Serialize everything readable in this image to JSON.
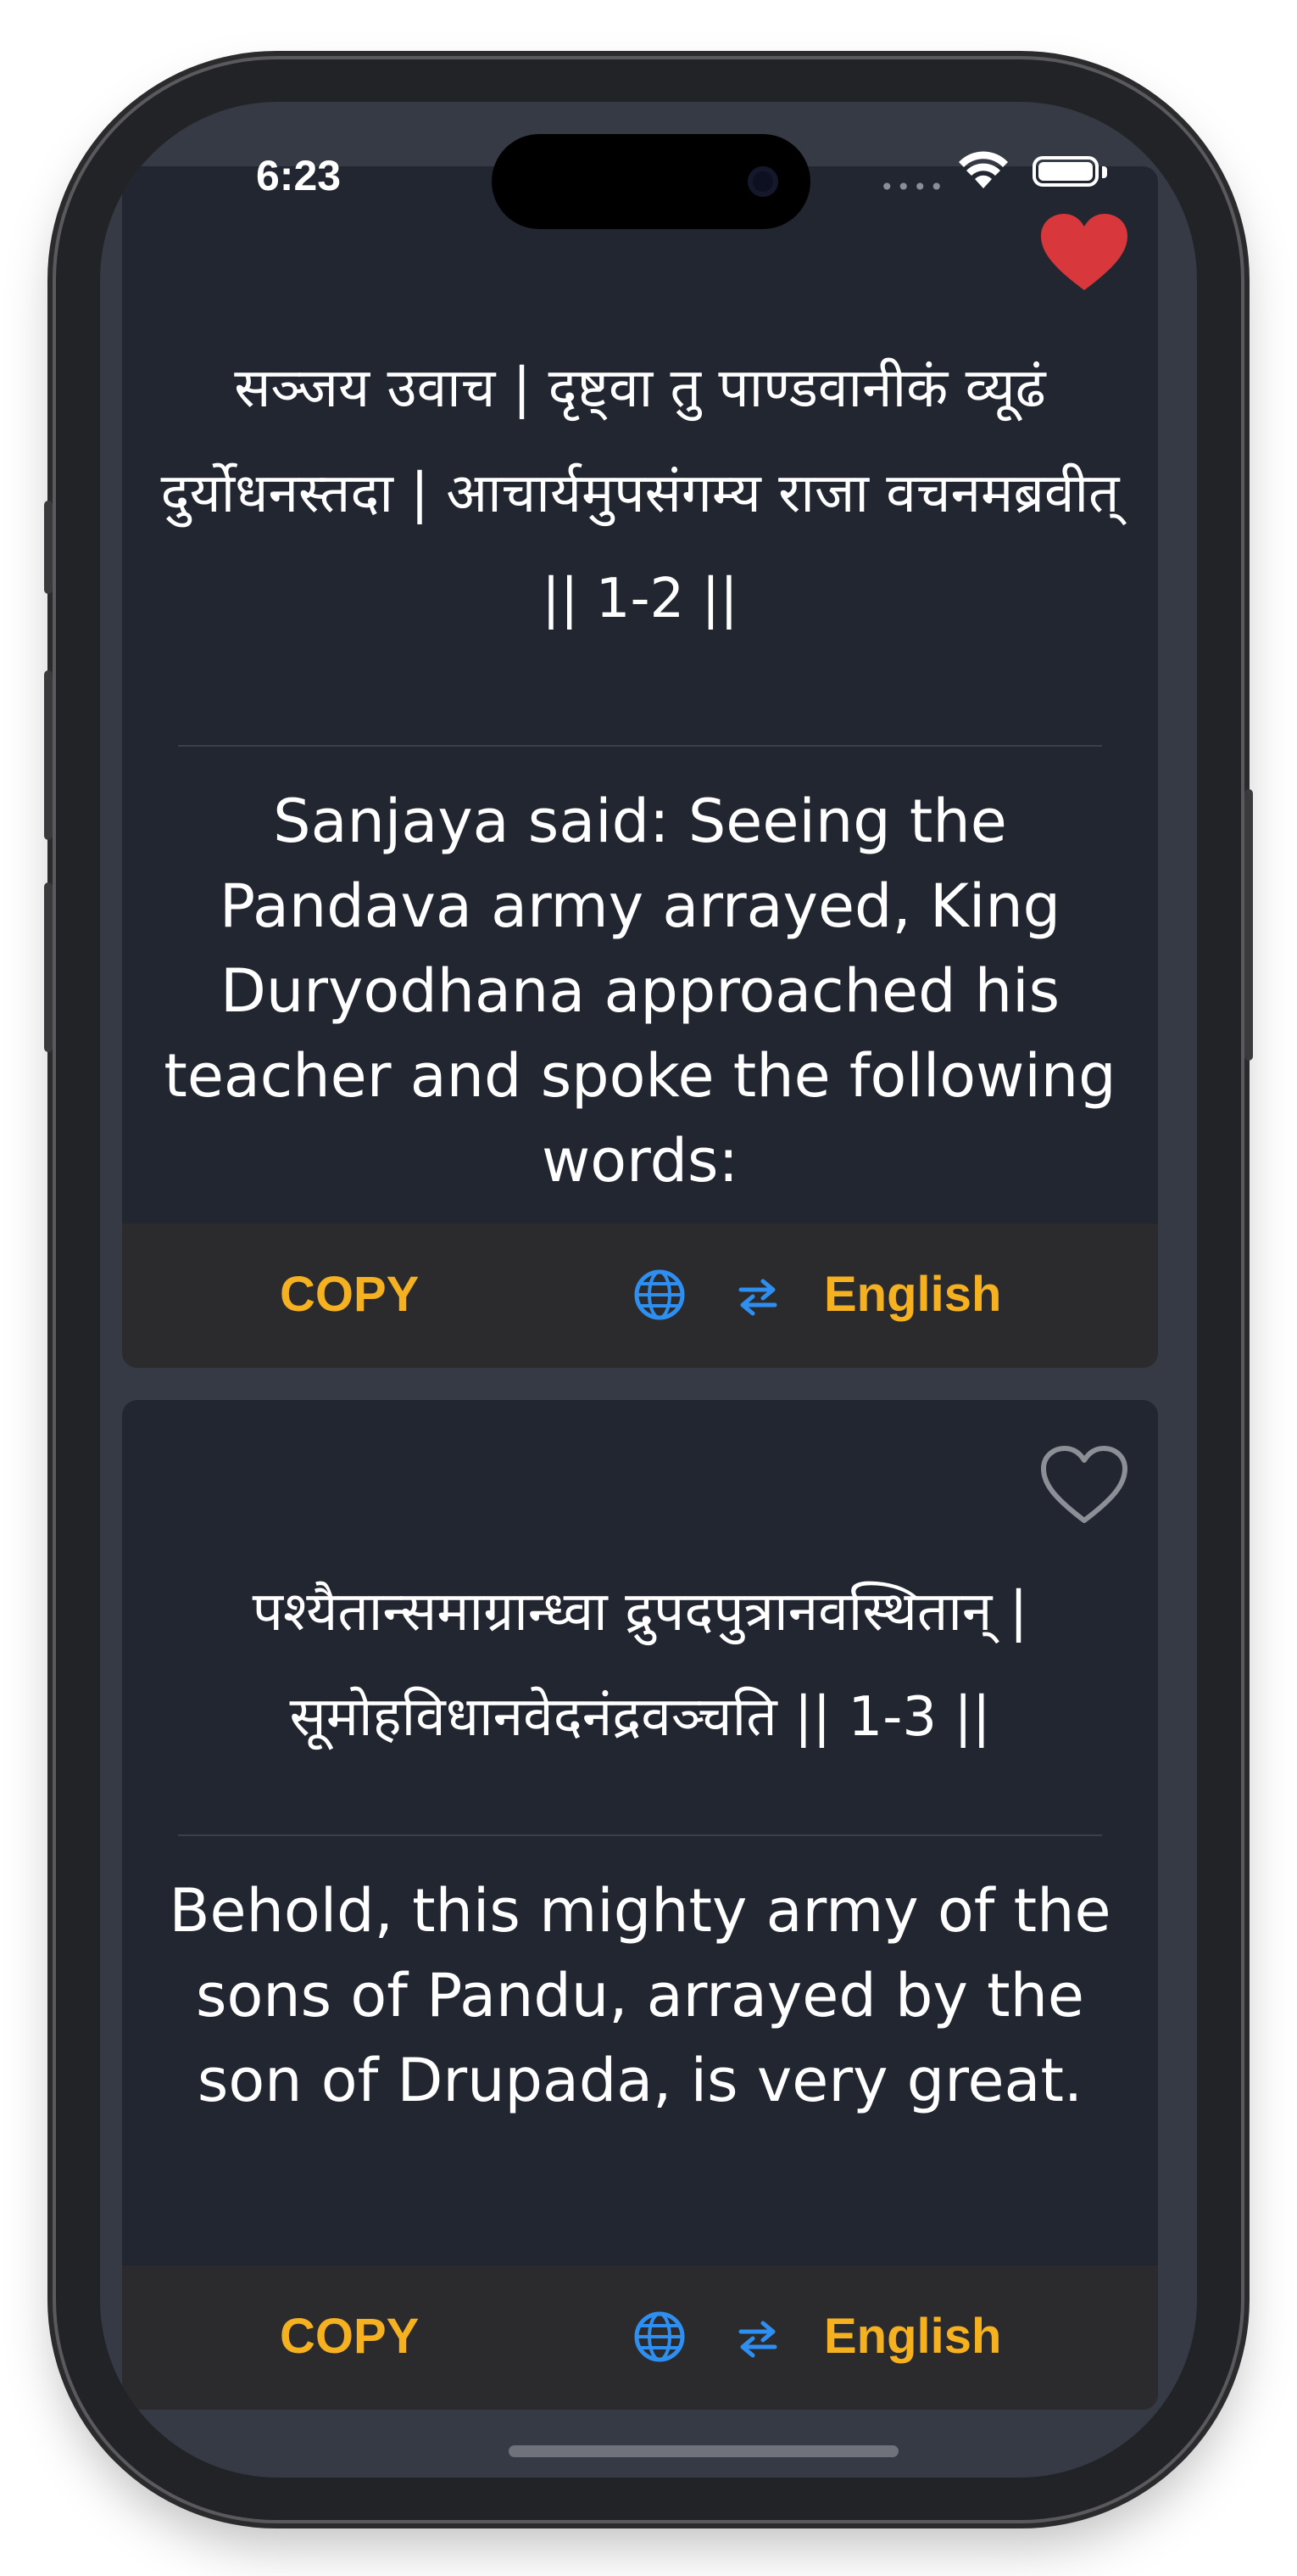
{
  "status_bar": {
    "time": "6:23",
    "cell_dots": "••••"
  },
  "verses": [
    {
      "favorited": true,
      "sanskrit": "सञ्जय उवाच | दृष्ट्वा तु पाण्डवानीकं व्यूढं दुर्योधनस्तदा | आचार्यमुपसंगम्य राजा वचनमब्रवीत् || 1-2 ||",
      "translation": "Sanjaya said: Seeing the Pandava army arrayed, King Duryodhana approached his teacher and spoke the following words:",
      "copy_label": "COPY",
      "language_label": "English"
    },
    {
      "favorited": false,
      "sanskrit": "पश्यैतान्समाग्रान्ध्वा द्रुपदपुत्रानवस्थितान् | सूमोहविधानवेदनंद्रवञ्चति || 1-3 ||",
      "translation": "Behold, this mighty army of the sons of Pandu, arrayed by the son of Drupada, is very great.",
      "copy_label": "COPY",
      "language_label": "English"
    }
  ],
  "colors": {
    "accent": "#f5b120",
    "icon_blue": "#2f8ff0",
    "heart_red": "#d8373c",
    "card_bg": "#222630",
    "action_bar_bg": "#2b2b2d"
  }
}
